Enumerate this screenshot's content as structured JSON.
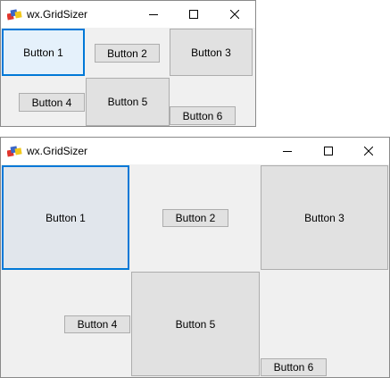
{
  "windows": [
    {
      "title": "wx.GridSizer",
      "controls": {
        "minimize": "minimize-icon",
        "maximize": "maximize-icon",
        "close": "close-icon"
      },
      "buttons": [
        "Button 1",
        "Button 2",
        "Button 3",
        "Button 4",
        "Button 5",
        "Button 6"
      ]
    },
    {
      "title": "wx.GridSizer",
      "controls": {
        "minimize": "minimize-icon",
        "maximize": "maximize-icon",
        "close": "close-icon"
      },
      "buttons": [
        "Button 1",
        "Button 2",
        "Button 3",
        "Button 4",
        "Button 5",
        "Button 6"
      ]
    }
  ],
  "colors": {
    "focus_border": "#0078d7",
    "button_face": "#e1e1e1",
    "client_bg": "#f0f0f0"
  }
}
